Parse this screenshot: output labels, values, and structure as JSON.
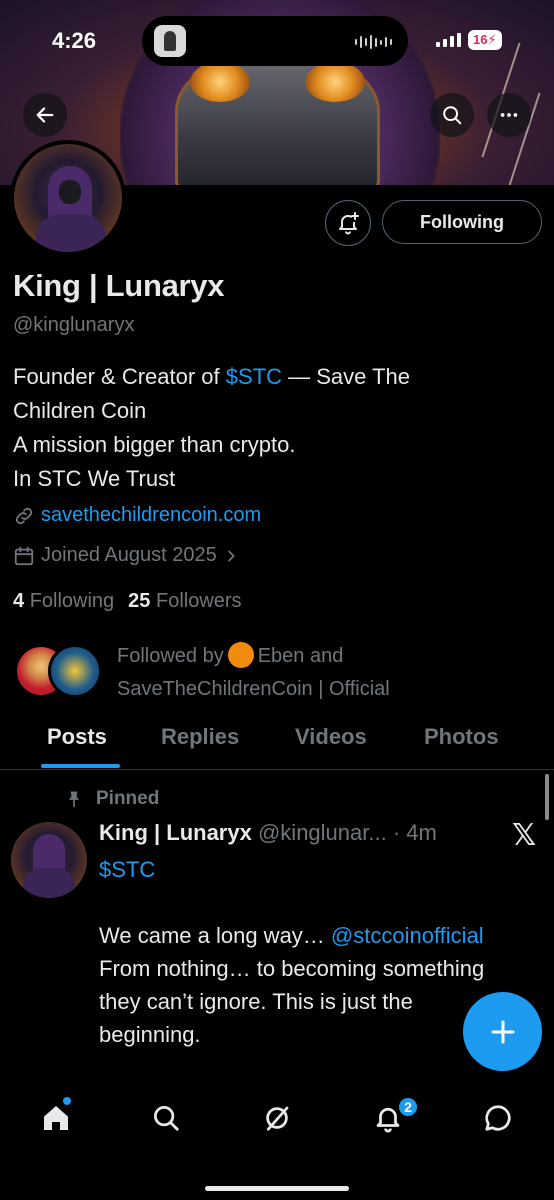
{
  "status_bar": {
    "time": "4:26",
    "battery": "16"
  },
  "header": {
    "back_icon": "arrow-left-icon",
    "search_icon": "search-icon",
    "more_icon": "more-icon"
  },
  "profile": {
    "display_name": "King | Lunaryx",
    "handle": "@kinglunaryx",
    "following_button": "Following",
    "bio": {
      "line1_prefix": "Founder & Creator of ",
      "line1_link": "$STC",
      "line1_suffix": " — Save The",
      "line2": "Children Coin",
      "line3": "A mission bigger than crypto.",
      "line4": "In STC We Trust"
    },
    "website": "savethechildrencoin.com",
    "joined": "Joined August 2025",
    "following_count": "4",
    "following_label": "Following",
    "followers_count": "25",
    "followers_label": "Followers",
    "followed_by_prefix": "Followed by",
    "followed_by_name1": "Eben and",
    "followed_by_name2": "SaveTheChildrenCoin | Official"
  },
  "tabs": [
    "Posts",
    "Replies",
    "Videos",
    "Photos"
  ],
  "active_tab": "Posts",
  "post": {
    "pinned_label": "Pinned",
    "author": "King | Lunaryx",
    "meta": "@kinglunar... · 4m",
    "ticker": "$STC",
    "text_line1_prefix": "We came a long way… ",
    "mention": "@stccoinofficial",
    "text_line2": "From nothing… to becoming something",
    "text_line3": "they can’t ignore. This is just the",
    "text_line4": "beginning."
  },
  "bottom_nav": {
    "items": [
      "home-icon",
      "search-icon",
      "grok-icon",
      "notifications-icon",
      "messages-icon"
    ],
    "notifications_badge": "2"
  },
  "colors": {
    "accent": "#1d9bf0",
    "background": "#000000",
    "secondary_text": "#71767b"
  }
}
